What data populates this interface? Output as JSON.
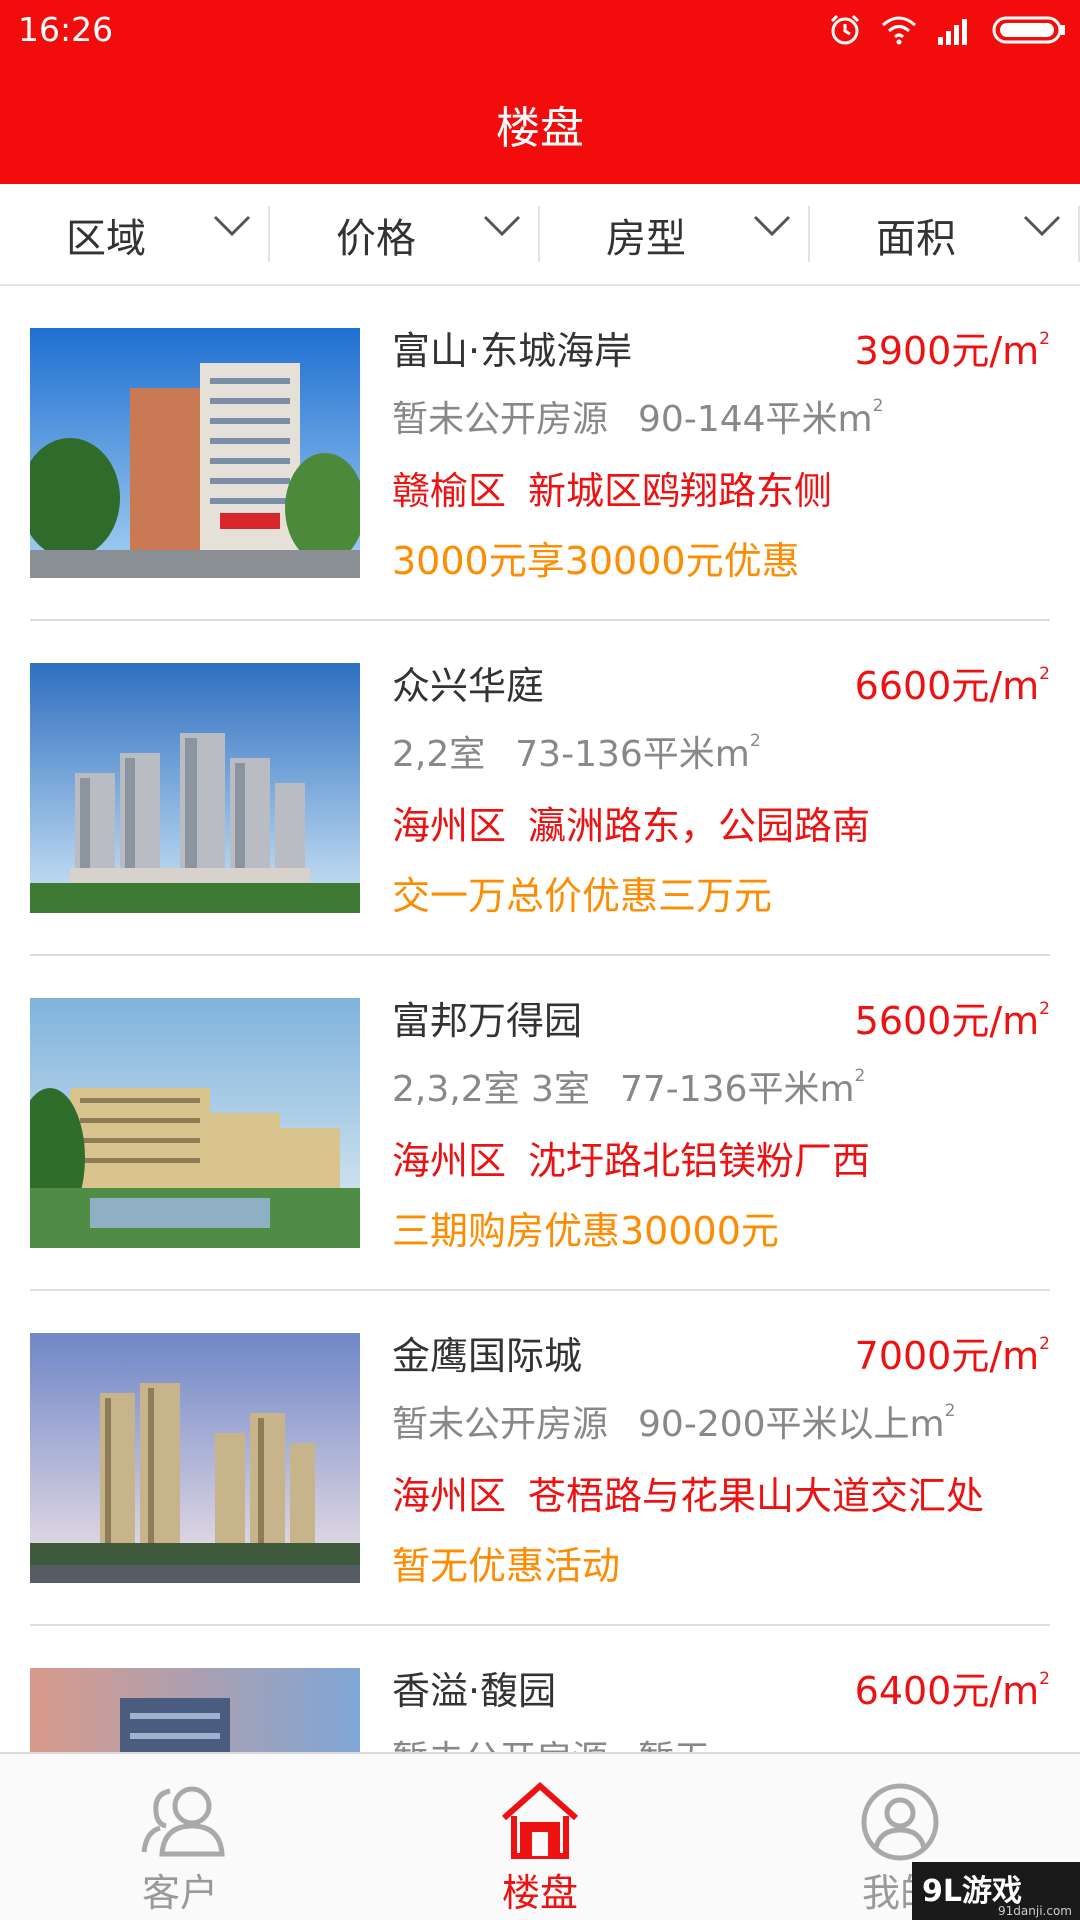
{
  "status_bar": {
    "time": "16:26"
  },
  "header": {
    "title": "楼盘"
  },
  "filters": [
    {
      "label": "区域"
    },
    {
      "label": "价格"
    },
    {
      "label": "房型"
    },
    {
      "label": "面积"
    }
  ],
  "listings": [
    {
      "name": "富山·东城海岸",
      "price": "3900元/m",
      "price_sup": "2",
      "spec_main": "暂未公开房源",
      "spec_area": "90-144平米m",
      "spec_sup": "2",
      "district": "赣榆区",
      "address": "新城区鸥翔路东侧",
      "promo": "3000元享30000元优惠"
    },
    {
      "name": "众兴华庭",
      "price": "6600元/m",
      "price_sup": "2",
      "spec_main": "2,2室",
      "spec_area": "73-136平米m",
      "spec_sup": "2",
      "district": "海州区",
      "address": "瀛洲路东，公园路南",
      "promo": "交一万总价优惠三万元"
    },
    {
      "name": "富邦万得园",
      "price": "5600元/m",
      "price_sup": "2",
      "spec_main": "2,3,2室 3室",
      "spec_area": "77-136平米m",
      "spec_sup": "2",
      "district": "海州区",
      "address": "沈圩路北铝镁粉厂西",
      "promo": "三期购房优惠30000元"
    },
    {
      "name": "金鹰国际城",
      "price": "7000元/m",
      "price_sup": "2",
      "spec_main": "暂未公开房源",
      "spec_area": "90-200平米以上m",
      "spec_sup": "2",
      "district": "海州区",
      "address": "苍梧路与花果山大道交汇处",
      "promo": "暂无优惠活动"
    },
    {
      "name": "香溢·馥园",
      "price": "6400元/m",
      "price_sup": "2",
      "spec_main": "暂未公开房源",
      "spec_area": "暂无",
      "spec_sup": "",
      "district": "",
      "address": "",
      "promo": ""
    }
  ],
  "tabs": [
    {
      "label": "客户",
      "icon": "users-icon"
    },
    {
      "label": "楼盘",
      "icon": "home-icon"
    },
    {
      "label": "我的",
      "icon": "profile-icon"
    }
  ],
  "watermark": {
    "logo": "9L游戏",
    "site": "91danji.com"
  },
  "colors": {
    "brand_red": "#f20c0c",
    "price_red": "#ee1111",
    "promo_orange": "#ff8c00"
  }
}
